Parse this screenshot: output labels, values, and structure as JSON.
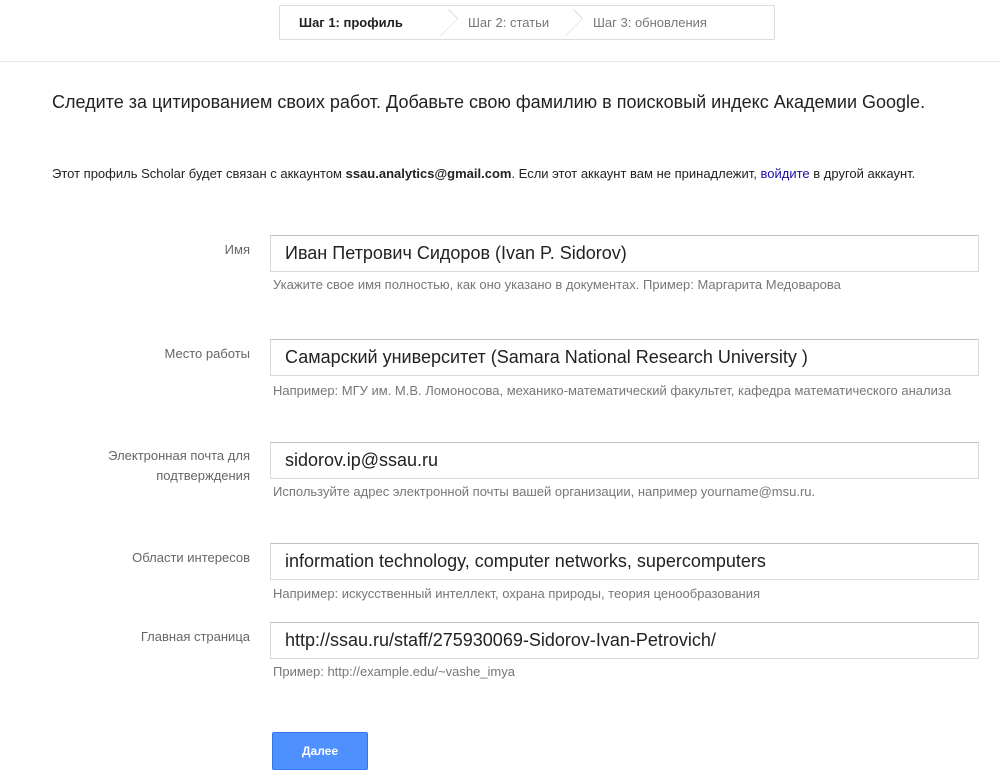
{
  "steps": [
    {
      "label": "Шаг 1: профиль",
      "active": true
    },
    {
      "label": "Шаг 2: статьи",
      "active": false
    },
    {
      "label": "Шаг 3: обновления",
      "active": false
    }
  ],
  "headline": "Следите за цитированием своих работ. Добавьте свою фамилию в поисковый индекс Академии Google.",
  "account_note": {
    "prefix": "Этот профиль Scholar будет связан с аккаунтом ",
    "email": "ssau.analytics@gmail.com",
    "middle": ". Если этот аккаунт вам не принадлежит, ",
    "link": "войдите",
    "suffix": " в другой аккаунт."
  },
  "form": {
    "name": {
      "label": "Имя",
      "value": "Иван Петрович Сидоров (Ivan P. Sidorov)",
      "hint": "Укажите свое имя полностью, как оно указано в документах. Пример: Маргарита Медоварова"
    },
    "affiliation": {
      "label": "Место работы",
      "value": "Самарский университет (Samara National Research University )",
      "hint": "Например: МГУ им. М.В. Ломоносова, механико-математический факультет, кафедра математического анализа"
    },
    "email": {
      "label": "Электронная почта для подтверждения",
      "value": "sidorov.ip@ssau.ru",
      "hint": "Используйте адрес электронной почты вашей организации, например yourname@msu.ru."
    },
    "interests": {
      "label": "Области интересов",
      "value": "information technology, computer networks, supercomputers",
      "hint": "Например: искусственный интеллект, охрана природы, теория ценообразования"
    },
    "homepage": {
      "label": "Главная страница",
      "value": "http://ssau.ru/staff/275930069-Sidorov-Ivan-Petrovich/",
      "hint": "Пример: http://example.edu/~vashe_imya"
    }
  },
  "next_button": "Далее",
  "colors": {
    "primary_button": "#4d90fe",
    "link": "#1a0dab"
  }
}
